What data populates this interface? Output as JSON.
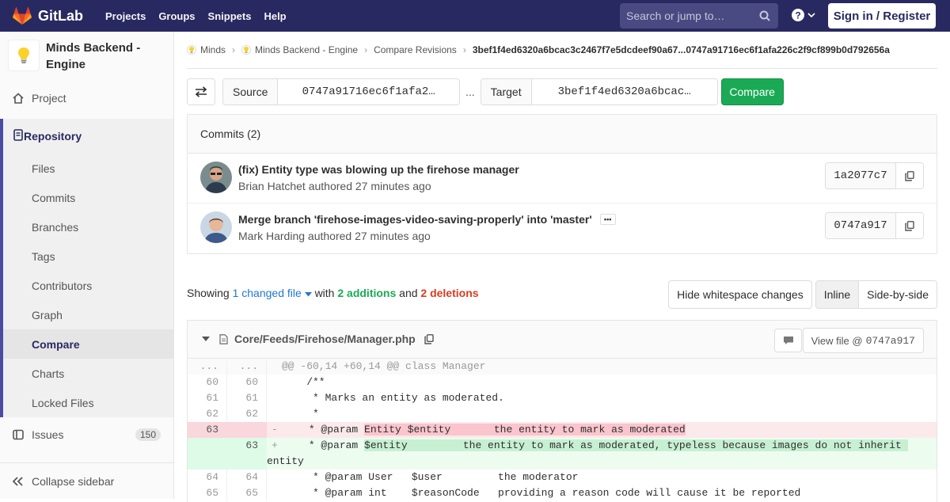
{
  "topbar": {
    "brand": "GitLab",
    "nav": [
      "Projects",
      "Groups",
      "Snippets",
      "Help"
    ],
    "search_placeholder": "Search or jump to…",
    "signin": "Sign in / Register",
    "brand_color": "#292961"
  },
  "sidebar": {
    "project_name": "Minds Backend - Engine",
    "project": "Project",
    "repository": "Repository",
    "sub_items": [
      "Files",
      "Commits",
      "Branches",
      "Tags",
      "Contributors",
      "Graph",
      "Compare",
      "Charts",
      "Locked Files"
    ],
    "active": "Compare",
    "issues": "Issues",
    "issues_count": "150",
    "collapse": "Collapse sidebar"
  },
  "breadcrumb": {
    "items": [
      "Minds",
      "Minds Backend - Engine",
      "Compare Revisions"
    ],
    "current": "3bef1f4ed6320a6bcac3c2467f7e5dcdeef90a67...0747a91716ec6f1afa226c2f9cf899b0d792656a"
  },
  "compare": {
    "source_label": "Source",
    "source_value": "0747a91716ec6f1afa2…",
    "dots": "...",
    "target_label": "Target",
    "target_value": "3bef1f4ed6320a6bcac…",
    "button": "Compare"
  },
  "commits": {
    "header": "Commits (2)",
    "items": [
      {
        "title": "(fix) Entity type was blowing up the firehose manager",
        "meta": "Brian Hatchet authored 27 minutes ago",
        "sha": "1a2077c7"
      },
      {
        "title": "Merge branch 'firehose-images-video-saving-properly' into 'master'",
        "meta": "Mark Harding authored 27 minutes ago",
        "sha": "0747a917"
      }
    ]
  },
  "summary": {
    "showing": "Showing",
    "changed": "1 changed file",
    "with": "with",
    "additions": "2 additions",
    "and": "and",
    "deletions": "2 deletions"
  },
  "view": {
    "whitespace": "Hide whitespace changes",
    "inline": "Inline",
    "side": "Side-by-side"
  },
  "file": {
    "path": "Core/Feeds/Firehose/Manager.php",
    "view_file": "View file @",
    "view_sha": "0747a917"
  },
  "diff": {
    "hunk": {
      "o": "...",
      "n": "...",
      "text": "@@ -60,14 +60,14 @@ class Manager"
    },
    "l1": {
      "o": "60",
      "n": "60",
      "text": "    /**"
    },
    "l2": {
      "o": "61",
      "n": "61",
      "text": "     * Marks an entity as moderated."
    },
    "l3": {
      "o": "62",
      "n": "62",
      "text": "     *"
    },
    "del": {
      "o": "63",
      "n": "",
      "sign": "-",
      "pre": "     * @param ",
      "hl": "Entity $entity       the entity to mark as moderated"
    },
    "add": {
      "o": "",
      "n": "63",
      "sign": "+",
      "pre": "     * @param ",
      "hl": "$entity         the entity to mark as moderated, typeless because images do not inherit ",
      "wrap": "entity"
    },
    "l4": {
      "o": "64",
      "n": "64",
      "text": "     * @param User   $user         the moderator"
    },
    "l5": {
      "o": "65",
      "n": "65",
      "text": "     * @param int    $reasonCode   providing a reason code will cause it be reported"
    }
  }
}
